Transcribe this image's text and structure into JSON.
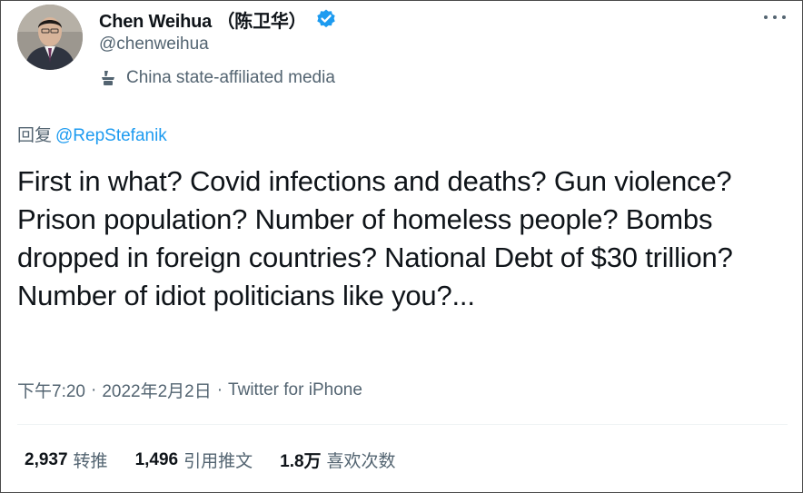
{
  "author": {
    "name": "Chen Weihua （陈卫华）",
    "handle": "@chenweihua",
    "affiliation": "China state-affiliated media"
  },
  "reply": {
    "prefix": "回复",
    "mention": "@RepStefanik"
  },
  "tweet": {
    "text": "First in what? Covid infections and deaths? Gun violence? Prison population? Number of homeless people? Bombs dropped in foreign countries? National Debt of $30 trillion? Number of idiot politicians like you?..."
  },
  "meta": {
    "time": "下午7:20",
    "separator": "·",
    "date": "2022年2月2日",
    "source": "Twitter for iPhone"
  },
  "stats": [
    {
      "value": "2,937",
      "label": "转推"
    },
    {
      "value": "1,496",
      "label": "引用推文"
    },
    {
      "value": "1.8万",
      "label": "喜欢次数"
    }
  ],
  "colors": {
    "accent": "#1d9bf0",
    "secondary_text": "#536471",
    "primary_text": "#0f1419",
    "divider": "#eff3f4"
  },
  "icons": {
    "verified": "verified-badge-icon",
    "affiliation": "state-media-icon",
    "more": "more-options-icon"
  }
}
